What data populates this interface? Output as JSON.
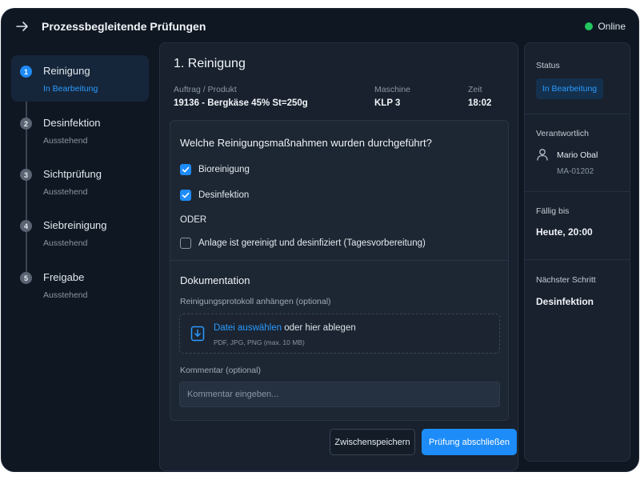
{
  "header": {
    "title": "Prozessbegleitende Prüfungen",
    "status": "Online",
    "status_color": "#22c55e"
  },
  "steps": [
    {
      "num": "1",
      "label": "Reinigung",
      "status": "In Bearbeitung"
    },
    {
      "num": "2",
      "label": "Desinfektion",
      "status": "Ausstehend"
    },
    {
      "num": "3",
      "label": "Sichtprüfung",
      "status": "Ausstehend"
    },
    {
      "num": "4",
      "label": "Siebreinigung",
      "status": "Ausstehend"
    },
    {
      "num": "5",
      "label": "Freigabe",
      "status": "Ausstehend"
    }
  ],
  "main": {
    "title": "1. Reinigung",
    "meta": {
      "order_label": "Auftrag / Produkt",
      "order_value": "19136 - Bergkäse 45% St=250g",
      "machine_label": "Maschine",
      "machine_value": "KLP 3",
      "time_label": "Zeit",
      "time_value": "18:02"
    },
    "question": "Welche Reinigungsmaßnahmen wurden durchgeführt?",
    "options": [
      {
        "label": "Bioreinigung",
        "checked": true
      },
      {
        "label": "Desinfektion",
        "checked": true
      }
    ],
    "or_label": "ODER",
    "alt_option": {
      "label": "Anlage ist gereinigt und desinfiziert (Tagesvorbereitung)",
      "checked": false
    },
    "documentation": {
      "title": "Dokumentation",
      "attach_label": "Reinigungsprotokoll anhängen (optional)",
      "file_link": "Datei auswählen",
      "file_text": " oder hier ablegen",
      "file_hint": "PDF, JPG, PNG (max. 10 MB)",
      "comment_label": "Kommentar (optional)",
      "comment_placeholder": "Kommentar eingeben..."
    },
    "buttons": {
      "save": "Zwischenspeichern",
      "complete": "Prüfung abschließen"
    }
  },
  "info": {
    "status_label": "Status",
    "status_value": "In Bearbeitung",
    "responsible_label": "Verantwortlich",
    "responsible_name": "Mario Obal",
    "responsible_id": "MA-01202",
    "due_label": "Fällig bis",
    "due_value": "Heute, 20:00",
    "next_label": "Nächster Schritt",
    "next_value": "Desinfektion"
  },
  "colors": {
    "accent": "#1d8cf8",
    "background": "#0f1722",
    "panel": "#18212d"
  }
}
